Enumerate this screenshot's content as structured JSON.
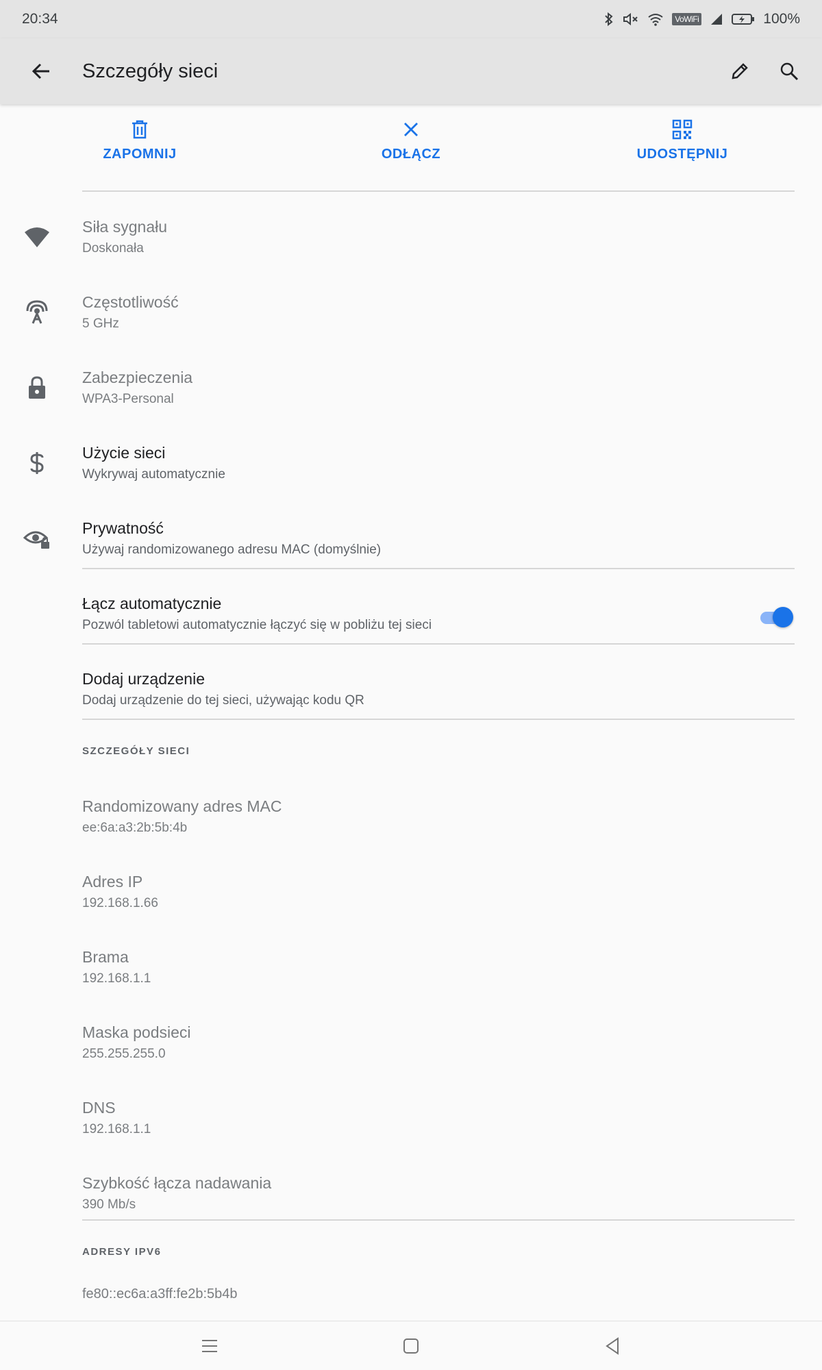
{
  "status_bar": {
    "time": "20:34",
    "vowifi": "VoWiFi",
    "battery": "100%"
  },
  "app_bar": {
    "title": "Szczegóły sieci"
  },
  "actions": {
    "forget": "ZAPOMNIJ",
    "disconnect": "ODŁĄCZ",
    "share": "UDOSTĘPNIJ"
  },
  "details": [
    {
      "title": "Siła sygnału",
      "value": "Doskonała"
    },
    {
      "title": "Częstotliwość",
      "value": "5 GHz"
    },
    {
      "title": "Zabezpieczenia",
      "value": "WPA3-Personal"
    },
    {
      "title": "Użycie sieci",
      "value": "Wykrywaj automatycznie"
    },
    {
      "title": "Prywatność",
      "value": "Używaj randomizowanego adresu MAC (domyślnie)"
    }
  ],
  "auto_connect": {
    "title": "Łącz automatycznie",
    "subtitle": "Pozwól tabletowi automatycznie łączyć się w pobliżu tej sieci",
    "enabled": true
  },
  "add_device": {
    "title": "Dodaj urządzenie",
    "subtitle": "Dodaj urządzenie do tej sieci, używając kodu QR"
  },
  "network_details_header": "SZCZEGÓŁY SIECI",
  "network_details": [
    {
      "title": "Randomizowany adres MAC",
      "value": "ee:6a:a3:2b:5b:4b"
    },
    {
      "title": "Adres IP",
      "value": "192.168.1.66"
    },
    {
      "title": "Brama",
      "value": "192.168.1.1"
    },
    {
      "title": "Maska podsieci",
      "value": "255.255.255.0"
    },
    {
      "title": "DNS",
      "value": "192.168.1.1"
    },
    {
      "title": "Szybkość łącza nadawania",
      "value": "390 Mb/s"
    }
  ],
  "ipv6_header": "ADRESY IPV6",
  "ipv6_address": "fe80::ec6a:a3ff:fe2b:5b4b",
  "colors": {
    "accent": "#1a73e8",
    "bar_bg": "#e4e4e4"
  }
}
